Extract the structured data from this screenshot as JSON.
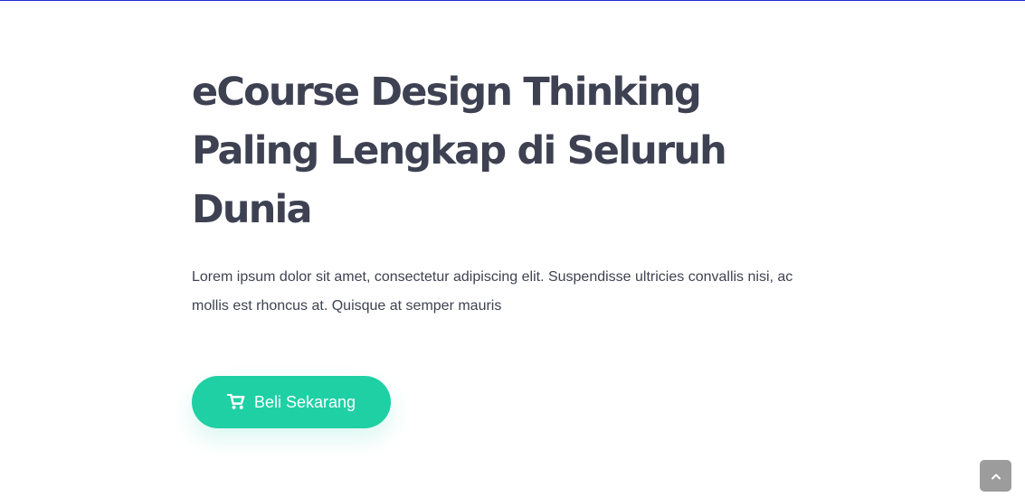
{
  "page": {
    "accent_color": "#20d0a5",
    "title_color": "#3d4152"
  },
  "hero": {
    "title": "eCourse Design Thinking Paling Lengkap di Seluruh Dunia",
    "description": "Lorem ipsum dolor sit amet, consectetur adipiscing elit. Suspendisse ultricies convallis nisi, ac mollis est rhoncus at. Quisque at semper mauris",
    "cta": {
      "label": "Beli Sekarang",
      "icon": "shopping-cart-icon"
    }
  },
  "scroll_control": {
    "icon": "chevron-up-icon"
  }
}
